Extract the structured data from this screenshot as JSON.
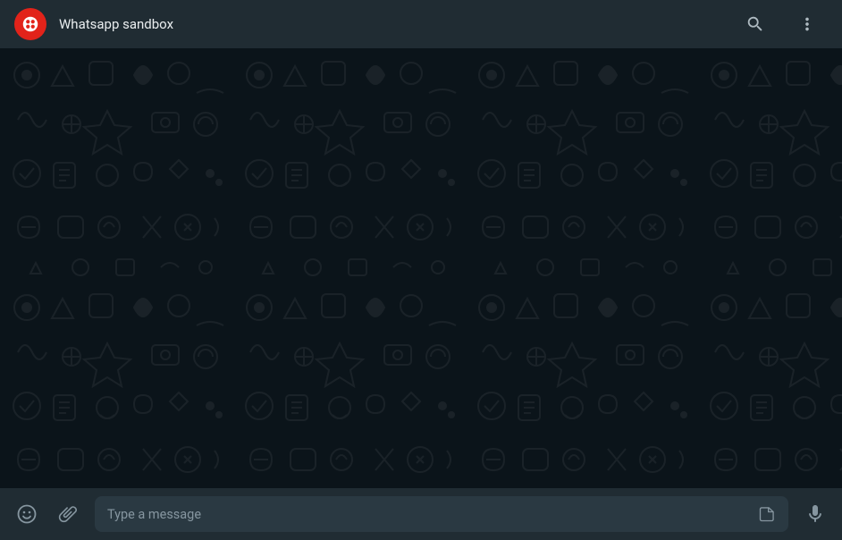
{
  "header": {
    "title": "Whatsapp sandbox",
    "avatar": {
      "type": "twilio-logo",
      "bg_color": "#e2231a"
    },
    "actions": {
      "search": "search-icon",
      "menu": "more-vertical-icon"
    }
  },
  "footer": {
    "emoji_button": "emoji-icon",
    "attach_button": "attach-icon",
    "input_placeholder": "Type a message",
    "input_value": "",
    "sticker_button": "sticker-icon",
    "mic_button": "microphone-icon"
  },
  "colors": {
    "header_bg": "#202c33",
    "chat_bg": "#0b141a",
    "input_bg": "#2a3942",
    "icon_color": "#8696a0",
    "text_color": "#e9edef"
  }
}
